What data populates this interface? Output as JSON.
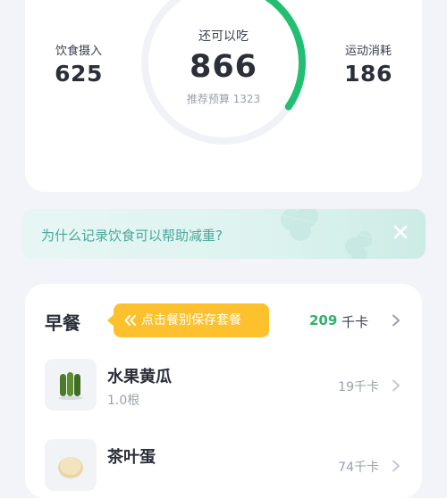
{
  "summary": {
    "intake_label": "饮食摄入",
    "intake_value": "625",
    "remaining_label": "还可以吃",
    "remaining_value": "866",
    "budget_text": "推荐预算 1323",
    "exercise_label": "运动消耗",
    "exercise_value": "186",
    "ring_progress": 0.345
  },
  "tip": {
    "text": "为什么记录饮食可以帮助减重?"
  },
  "meal": {
    "title": "早餐",
    "save_tip": "点击餐别保存套餐",
    "kcal": "209",
    "kcal_unit": "千卡",
    "items": [
      {
        "name": "水果黄瓜",
        "amount": "1.0根",
        "kcal": "19千卡"
      },
      {
        "name": "茶叶蛋",
        "amount": "",
        "kcal": "74千卡"
      }
    ]
  },
  "colors": {
    "ring_progress": "#22bf72",
    "ring_track": "#f1f2f7",
    "accent_green": "#2fb36c",
    "tip_text": "#49a89b",
    "save_tip_bg": "#fcc12d"
  },
  "icons": {
    "tip_close": "close-icon",
    "meal_chevron": "chevron-right-icon",
    "save_tip_arrows": "double-chevron-left-icon"
  }
}
